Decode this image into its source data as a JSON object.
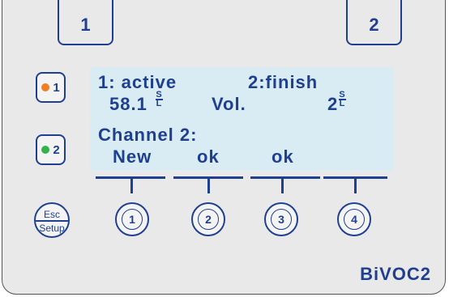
{
  "tabs": [
    {
      "label": "1"
    },
    {
      "label": "2"
    }
  ],
  "side_buttons": [
    {
      "label": "1",
      "led_color": "#ef7d22"
    },
    {
      "label": "2",
      "led_color": "#33b34a"
    }
  ],
  "display": {
    "line1_left": "1: active",
    "line1_right": "2:finish",
    "value1": "58.1",
    "unit_top": "S",
    "unit_bottom": "L",
    "mid_label": "Vol.",
    "value2": "2",
    "line3": "Channel 2:",
    "soft_labels": [
      "New",
      "ok",
      "ok"
    ]
  },
  "softkeys": [
    {
      "label": "1"
    },
    {
      "label": "2"
    },
    {
      "label": "3"
    },
    {
      "label": "4"
    }
  ],
  "esc_button": {
    "top": "Esc",
    "bottom": "Setup"
  },
  "brand": "BiVOC2",
  "colors": {
    "accent": "#1f3f8f",
    "lcd": "#d9ecf3",
    "panel": "#e9e9ea"
  }
}
